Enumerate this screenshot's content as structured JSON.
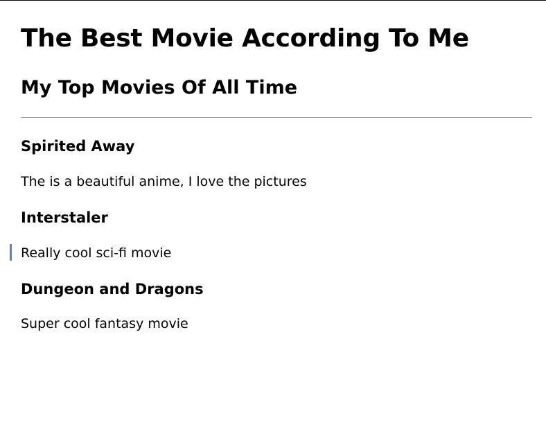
{
  "page": {
    "title": "The Best Movie According To Me",
    "subtitle": "My Top Movies Of All Time"
  },
  "movies": [
    {
      "title": "Spirited Away",
      "description": "The is a beautiful anime, I love the pictures"
    },
    {
      "title": "Interstaler",
      "description": "Really cool sci-fi movie"
    },
    {
      "title": "Dungeon and Dragons",
      "description": "Super cool fantasy movie"
    }
  ],
  "colors": {
    "text": "#000000",
    "divider": "#9a9a9a",
    "marker": "#6b7fa8"
  }
}
